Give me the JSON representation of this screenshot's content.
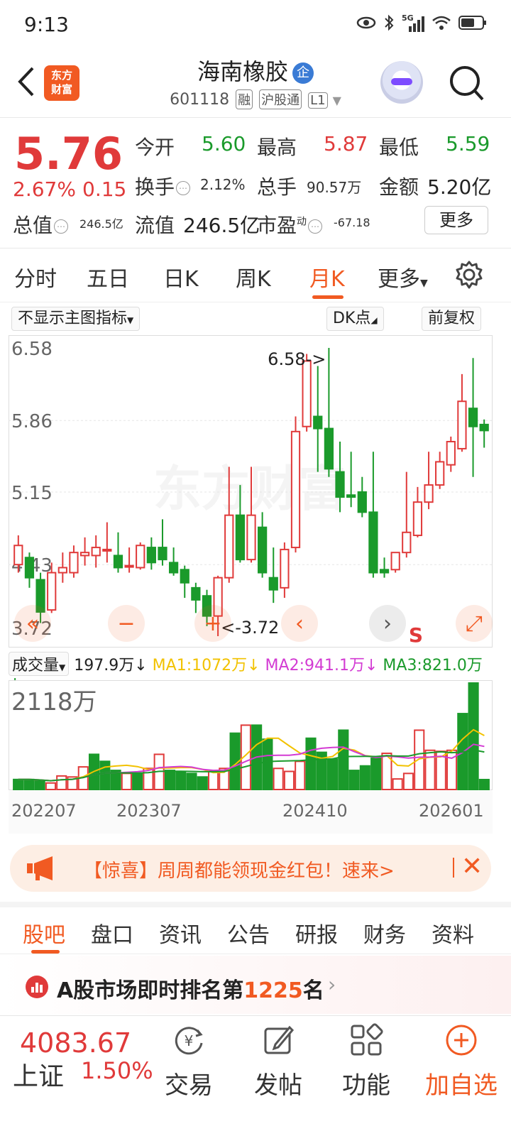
{
  "status_bar": {
    "time": "9:13",
    "network": "5G"
  },
  "header": {
    "brand_line1": "东方",
    "brand_line2": "财富",
    "stock_name": "海南橡胶",
    "enterprise_badge": "企",
    "stock_code": "601118",
    "tags": [
      "融",
      "沪股通",
      "L1"
    ]
  },
  "quote": {
    "price": "5.76",
    "change_pct": "2.67%",
    "change_amt": "0.15",
    "open_label": "今开",
    "open": "5.60",
    "high_label": "最高",
    "high": "5.87",
    "low_label": "最低",
    "low": "5.59",
    "turnover_label": "换手",
    "turnover": "2.12%",
    "volume_label": "总手",
    "volume": "90.57万",
    "amount_label": "金额",
    "amount": "5.20亿",
    "mktcap_label": "总值",
    "mktcap": "246.5亿",
    "float_label": "流值",
    "float_cap": "246.5亿",
    "pe_label": "市盈",
    "pe_sup": "动",
    "pe": "-67.18",
    "more_button": "更多"
  },
  "period_tabs": [
    "分时",
    "五日",
    "日K",
    "周K",
    "月K",
    "更多"
  ],
  "active_period": "月K",
  "chart_toolbar": {
    "indicator": "不显示主图指标",
    "dk": "DK点",
    "adjust": "前复权"
  },
  "chart_data": [
    {
      "type": "candlestick",
      "y_ticks": [
        "6.58",
        "5.86",
        "5.15",
        "4.43",
        "3.72"
      ],
      "ylim": [
        3.72,
        6.58
      ],
      "max_label": "6.58->",
      "min_label": "<-3.72",
      "signal_label": "S",
      "watermark": "东方财富",
      "candles": [
        {
          "o": 4.43,
          "c": 4.62,
          "h": 4.72,
          "l": 4.35
        },
        {
          "o": 4.5,
          "c": 4.3,
          "h": 4.55,
          "l": 4.2
        },
        {
          "o": 4.28,
          "c": 3.96,
          "h": 4.35,
          "l": 3.85
        },
        {
          "o": 3.98,
          "c": 4.35,
          "h": 4.45,
          "l": 3.95
        },
        {
          "o": 4.35,
          "c": 4.4,
          "h": 4.55,
          "l": 4.25
        },
        {
          "o": 4.35,
          "c": 4.55,
          "h": 4.62,
          "l": 4.3
        },
        {
          "o": 4.52,
          "c": 4.55,
          "h": 4.7,
          "l": 4.42
        },
        {
          "o": 4.52,
          "c": 4.6,
          "h": 4.72,
          "l": 4.4
        },
        {
          "o": 4.58,
          "c": 4.58,
          "h": 4.85,
          "l": 4.45
        },
        {
          "o": 4.52,
          "c": 4.4,
          "h": 4.75,
          "l": 4.35
        },
        {
          "o": 4.42,
          "c": 4.42,
          "h": 4.6,
          "l": 4.35
        },
        {
          "o": 4.4,
          "c": 4.62,
          "h": 4.65,
          "l": 4.38
        },
        {
          "o": 4.6,
          "c": 4.45,
          "h": 4.7,
          "l": 4.38
        },
        {
          "o": 4.6,
          "c": 4.48,
          "h": 4.88,
          "l": 4.42
        },
        {
          "o": 4.45,
          "c": 4.35,
          "h": 4.6,
          "l": 4.32
        },
        {
          "o": 4.38,
          "c": 4.25,
          "h": 4.42,
          "l": 4.1
        },
        {
          "o": 4.2,
          "c": 4.08,
          "h": 4.25,
          "l": 3.95
        },
        {
          "o": 4.12,
          "c": 3.92,
          "h": 4.18,
          "l": 3.82
        },
        {
          "o": 3.92,
          "c": 4.3,
          "h": 4.32,
          "l": 3.72
        },
        {
          "o": 4.3,
          "c": 4.92,
          "h": 5.4,
          "l": 4.25
        },
        {
          "o": 4.92,
          "c": 4.48,
          "h": 5.22,
          "l": 4.45
        },
        {
          "o": 4.48,
          "c": 4.92,
          "h": 5.4,
          "l": 4.45
        },
        {
          "o": 4.8,
          "c": 4.35,
          "h": 4.95,
          "l": 4.3
        },
        {
          "o": 4.3,
          "c": 4.18,
          "h": 4.6,
          "l": 4.05
        },
        {
          "o": 4.2,
          "c": 4.58,
          "h": 4.65,
          "l": 4.1
        },
        {
          "o": 4.6,
          "c": 5.75,
          "h": 5.9,
          "l": 4.55
        },
        {
          "o": 5.8,
          "c": 6.45,
          "h": 6.52,
          "l": 5.75
        },
        {
          "o": 5.9,
          "c": 5.78,
          "h": 6.4,
          "l": 5.35
        },
        {
          "o": 5.78,
          "c": 5.38,
          "h": 6.58,
          "l": 5.3
        },
        {
          "o": 5.35,
          "c": 5.1,
          "h": 5.65,
          "l": 4.95
        },
        {
          "o": 5.12,
          "c": 5.1,
          "h": 5.55,
          "l": 5.0
        },
        {
          "o": 5.15,
          "c": 4.95,
          "h": 5.3,
          "l": 4.9
        },
        {
          "o": 4.95,
          "c": 4.35,
          "h": 5.55,
          "l": 4.3
        },
        {
          "o": 4.38,
          "c": 4.35,
          "h": 4.5,
          "l": 4.3
        },
        {
          "o": 4.38,
          "c": 4.55,
          "h": 4.55,
          "l": 4.35
        },
        {
          "o": 4.55,
          "c": 4.75,
          "h": 5.35,
          "l": 4.5
        },
        {
          "o": 4.72,
          "c": 5.05,
          "h": 5.2,
          "l": 4.7
        },
        {
          "o": 5.05,
          "c": 5.22,
          "h": 5.55,
          "l": 4.98
        },
        {
          "o": 5.22,
          "c": 5.45,
          "h": 5.55,
          "l": 5.18
        },
        {
          "o": 5.42,
          "c": 5.65,
          "h": 5.7,
          "l": 5.35
        },
        {
          "o": 5.58,
          "c": 6.05,
          "h": 6.32,
          "l": 5.55
        },
        {
          "o": 5.98,
          "c": 5.8,
          "h": 6.48,
          "l": 5.3
        },
        {
          "o": 5.82,
          "c": 5.76,
          "h": 5.87,
          "l": 5.59
        }
      ]
    },
    {
      "type": "bar",
      "label": "成交量",
      "current_volume": "197.9万↓",
      "ma1": "MA1:1072万↓",
      "ma2": "MA2:941.1万↓",
      "ma3": "MA3:821.0万↓",
      "y_max_label": "2118万",
      "x_ticks": [
        "202207",
        "202307",
        "202410",
        "202601"
      ],
      "volumes": [
        200,
        200,
        170,
        130,
        270,
        250,
        450,
        700,
        560,
        380,
        320,
        320,
        420,
        700,
        380,
        360,
        320,
        250,
        360,
        420,
        1120,
        1280,
        1280,
        1000,
        420,
        360,
        560,
        1020,
        740,
        600,
        1180,
        380,
        470,
        620,
        720,
        210,
        320,
        1180,
        780,
        760,
        780,
        1510,
        2118,
        198
      ],
      "colors_up": [
        false,
        false,
        false,
        true,
        true,
        true,
        true,
        false,
        false,
        false,
        true,
        false,
        true,
        true,
        false,
        false,
        false,
        false,
        true,
        true,
        false,
        true,
        false,
        false,
        true,
        true,
        true,
        false,
        false,
        false,
        false,
        false,
        false,
        false,
        true,
        true,
        true,
        true,
        true,
        true,
        true,
        false,
        false
      ]
    }
  ],
  "promo": {
    "text": "【惊喜】周周都能领现金红包！速来>"
  },
  "info_tabs": [
    "股吧",
    "盘口",
    "资讯",
    "公告",
    "研报",
    "财务",
    "资料"
  ],
  "active_info_tab": "股吧",
  "ranking": {
    "prefix": "A股市场即时排名第",
    "rank": "1225",
    "suffix": "名"
  },
  "bottom_bar": {
    "index_value": "4083.67",
    "index_name": "上证",
    "index_pct": "1.50%",
    "buttons": [
      "交易",
      "发帖",
      "功能",
      "加自选"
    ]
  },
  "colors": {
    "accent": "#f15a22",
    "up": "#e03a3a",
    "down": "#1a9a2b"
  }
}
